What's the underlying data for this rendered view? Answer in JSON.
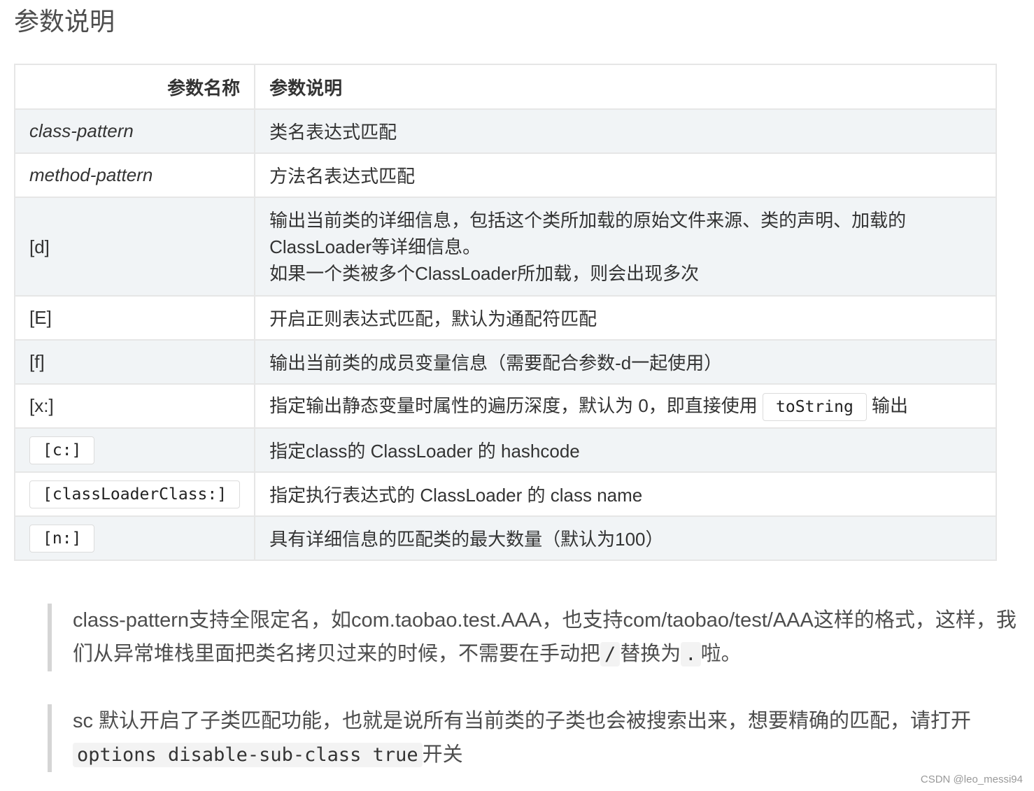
{
  "page_title": "参数说明",
  "table": {
    "headers": [
      "参数名称",
      "参数说明"
    ],
    "rows": [
      {
        "name": "class-pattern",
        "desc": [
          "类名表达式匹配"
        ]
      },
      {
        "name": "method-pattern",
        "desc": [
          "方法名表达式匹配"
        ]
      },
      {
        "name": "[d]",
        "desc": [
          "输出当前类的详细信息，包括这个类所加载的原始文件来源、类的声明、加载的",
          "ClassLoader等详细信息。",
          "如果一个类被多个ClassLoader所加载，则会出现多次"
        ]
      },
      {
        "name": "[E]",
        "desc": [
          "开启正则表达式匹配，默认为通配符匹配"
        ]
      },
      {
        "name": "[f]",
        "desc": [
          "输出当前类的成员变量信息（需要配合参数-d一起使用）"
        ]
      },
      {
        "name": "[x:]",
        "desc_before": "指定输出静态变量时属性的遍历深度，默认为 0，即直接使用 ",
        "desc_code": "toString",
        "desc_after": " 输出"
      },
      {
        "name_code": "[c:]",
        "desc": [
          "指定class的 ClassLoader 的 hashcode"
        ]
      },
      {
        "name_code": "[classLoaderClass:]",
        "desc": [
          "指定执行表达式的 ClassLoader 的 class name"
        ]
      },
      {
        "name_code": "[n:]",
        "desc": [
          "具有详细信息的匹配类的最大数量（默认为100）"
        ]
      }
    ]
  },
  "quote1": {
    "text_before": "class-pattern支持全限定名，如com.taobao.test.AAA，也支持com/taobao/test/AAA这样的格式，这样，我们从异常堆栈里面把类名拷贝过来的时候，不需要在手动把",
    "code1": "/",
    "text_mid": "替换为",
    "code2": ".",
    "text_after": "啦。"
  },
  "quote2": {
    "text_before": "sc 默认开启了子类匹配功能，也就是说所有当前类的子类也会被搜索出来，想要精确的匹配，请打开",
    "code": "options disable-sub-class true",
    "text_after": "开关"
  },
  "watermark": "CSDN @leo_messi94"
}
